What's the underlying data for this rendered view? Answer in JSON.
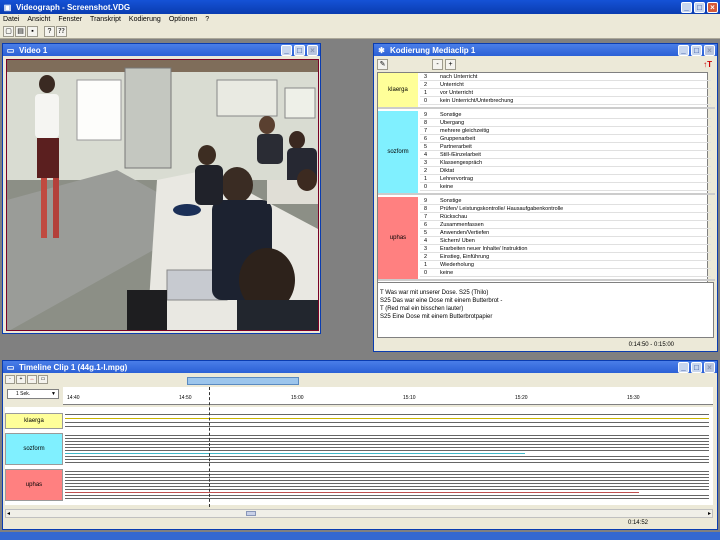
{
  "app": {
    "title": "Videograph - Screenshot.VDG",
    "menu": [
      "Datei",
      "Ansicht",
      "Fenster",
      "Transkript",
      "Kodierung",
      "Optionen",
      "?"
    ]
  },
  "video_window": {
    "title": "Video 1"
  },
  "coding_window": {
    "title": "Kodierung Mediaclip 1",
    "buttons": {
      "minus": "-",
      "plus": "+"
    },
    "categories": [
      {
        "name": "klaerga",
        "color": "#ffff99",
        "rows": [
          {
            "n": "3",
            "text": "nach Unterricht"
          },
          {
            "n": "2",
            "text": "Unterricht"
          },
          {
            "n": "1",
            "text": "vor Unterricht"
          },
          {
            "n": "0",
            "text": "kein Unterricht/Unterbrechung"
          }
        ]
      },
      {
        "name": "sozform",
        "color": "#80f0ff",
        "rows": [
          {
            "n": "9",
            "text": "Sonstige"
          },
          {
            "n": "8",
            "text": "Übergang"
          },
          {
            "n": "7",
            "text": "mehrere gleichzeitig"
          },
          {
            "n": "6",
            "text": "Gruppenarbeit"
          },
          {
            "n": "5",
            "text": "Partnerarbeit"
          },
          {
            "n": "4",
            "text": "Still-/Einzelarbeit"
          },
          {
            "n": "3",
            "text": "Klassengespräch"
          },
          {
            "n": "2",
            "text": "Diktat"
          },
          {
            "n": "1",
            "text": "Lehrervortrag"
          },
          {
            "n": "0",
            "text": "keine"
          }
        ]
      },
      {
        "name": "uphas",
        "color": "#ff8080",
        "rows": [
          {
            "n": "9",
            "text": "Sonstige"
          },
          {
            "n": "8",
            "text": "Prüfen/ Leistungskontrolle/ Hausaufgabenkontrolle"
          },
          {
            "n": "7",
            "text": "Rückschau"
          },
          {
            "n": "6",
            "text": "Zusammenfassen"
          },
          {
            "n": "5",
            "text": "Anwenden/Vertiefen"
          },
          {
            "n": "4",
            "text": "Sichern/ Üben"
          },
          {
            "n": "3",
            "text": "Erarbeiten neuer Inhalte/ Instruktion"
          },
          {
            "n": "2",
            "text": "Einstieg, Einführung"
          },
          {
            "n": "1",
            "text": "Wiederholung"
          },
          {
            "n": "0",
            "text": "keine"
          }
        ]
      }
    ],
    "transcript": [
      "T Was war mit unserer Dose. S25 (Thilo)",
      "S25 Das war eine Dose mit einem Butterbrot -",
      "T (Red mal ein bisschen lauter)",
      "S25 Eine Dose mit einem Butterbrotpapier"
    ],
    "time_range": "0:14:50 - 0:15:00"
  },
  "timeline_window": {
    "title": "Timeline Clip 1 (44g.1-l.mpg)",
    "scale": "1 Sek.",
    "ticks": [
      "14:40",
      "14:50",
      "15:00",
      "15:10",
      "15:20",
      "15:30"
    ],
    "tracks": [
      "klaerga",
      "sozform",
      "uphas"
    ],
    "current_time": "0:14:52"
  }
}
